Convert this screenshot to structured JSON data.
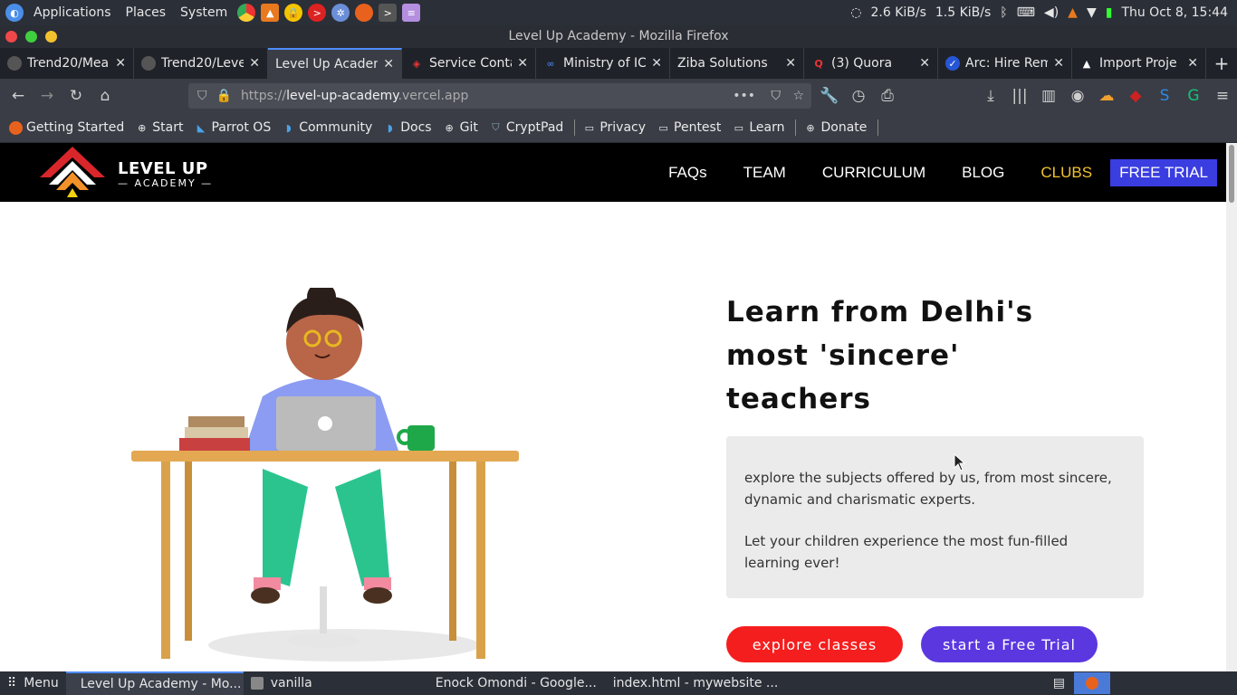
{
  "system_bar": {
    "applications": "Applications",
    "places": "Places",
    "system": "System",
    "net_down": "2.6 KiB/s",
    "net_up": "1.5 KiB/s",
    "clock": "Thu Oct  8, 15:44"
  },
  "window": {
    "title": "Level Up Academy - Mozilla Firefox"
  },
  "tabs": [
    {
      "label": "Trend20/Mea",
      "icon": "github-icon"
    },
    {
      "label": "Trend20/Leve",
      "icon": "github-icon"
    },
    {
      "label": "Level Up Academ",
      "icon": "none",
      "active": true
    },
    {
      "label": "Service Conta",
      "icon": "laravel-icon"
    },
    {
      "label": "Ministry of IC",
      "icon": "infinity-icon"
    },
    {
      "label": "Ziba Solutions",
      "icon": "none"
    },
    {
      "label": "(3) Quora",
      "icon": "quora-icon"
    },
    {
      "label": "Arc: Hire Rem",
      "icon": "arc-icon"
    },
    {
      "label": "Import Proje",
      "icon": "import-icon"
    }
  ],
  "url": {
    "prefix": "https://",
    "host": "level-up-academy",
    "suffix": ".vercel.app"
  },
  "bookmarks": [
    {
      "label": "Getting Started",
      "icon": "firefox-icon"
    },
    {
      "label": "Start",
      "icon": "globe-icon"
    },
    {
      "label": "Parrot OS",
      "icon": "parrot-icon"
    },
    {
      "label": "Community",
      "icon": "parrot-icon"
    },
    {
      "label": "Docs",
      "icon": "parrot-icon"
    },
    {
      "label": "Git",
      "icon": "globe-icon"
    },
    {
      "label": "CryptPad",
      "icon": "shield-icon"
    },
    {
      "label": "Privacy",
      "icon": "folder-icon"
    },
    {
      "label": "Pentest",
      "icon": "folder-icon"
    },
    {
      "label": "Learn",
      "icon": "folder-icon"
    },
    {
      "label": "Donate",
      "icon": "globe-icon"
    }
  ],
  "site": {
    "logo_main": "LEVEL UP",
    "logo_sub": "ACADEMY",
    "menu": [
      "FAQs",
      "TEAM",
      "CURRICULUM",
      "BLOG",
      "CLUBS",
      "FREE TRIAL"
    ],
    "hero_title": "Learn from Delhi's most 'sincere' teachers",
    "card_p1": "explore the subjects offered by us, from most sincere, dynamic and charismatic experts.",
    "card_p2": "Let your children experience the most fun-filled learning ever!",
    "btn_explore": "explore classes",
    "btn_trial": "start a Free Trial"
  },
  "taskbar": {
    "menu": "Menu",
    "items": [
      {
        "label": "Level Up Academy - Mo...",
        "active": true
      },
      {
        "label": "vanilla"
      },
      {
        "label": "Enock Omondi - Google..."
      },
      {
        "label": "index.html - mywebsite ..."
      }
    ]
  },
  "colors": {
    "accent_red": "#f51e1e",
    "accent_purple": "#5b37e0",
    "clubs_gold": "#f2c230",
    "trial_blue": "#3a3de0"
  }
}
